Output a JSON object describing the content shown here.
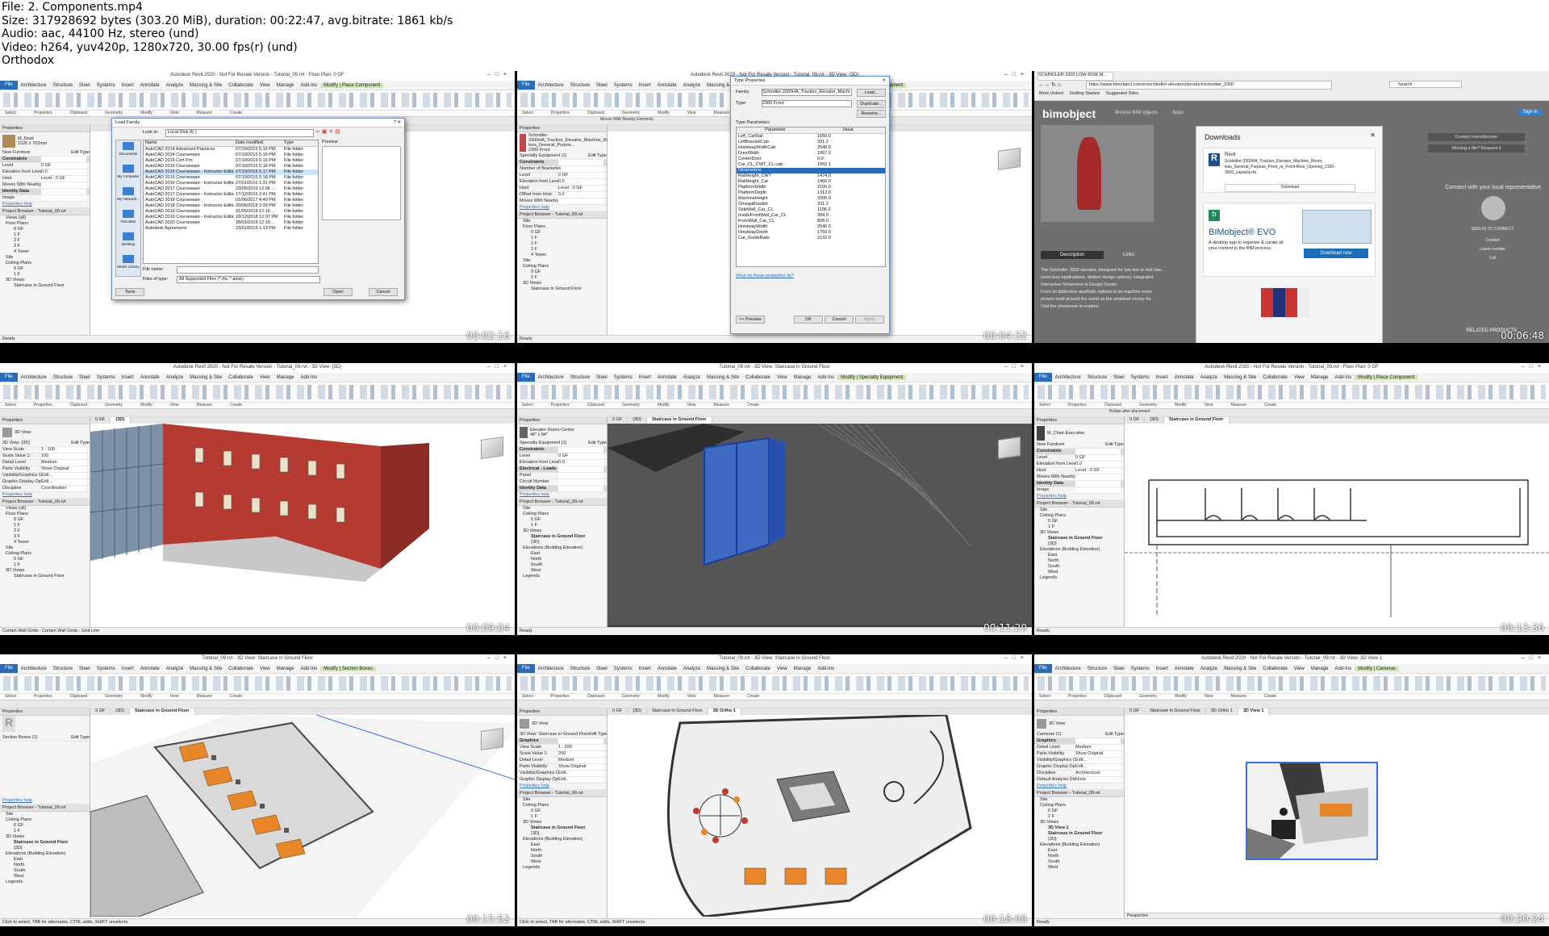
{
  "header": {
    "file": "File: 2. Components.mp4",
    "size": "Size: 317928692 bytes (303.20 MiB), duration: 00:22:47, avg.bitrate: 1861 kb/s",
    "audio": "Audio: aac, 44100 Hz, stereo (und)",
    "video": "Video: h264, yuv420p, 1280x720, 30.00 fps(r) (und)",
    "brand": "Orthodox"
  },
  "colors": {
    "revit_file_tab": "#2b6cb6",
    "context_tab": "#cfe8b8",
    "selection_blue": "#3a6fd8",
    "bim_green": "#2e9a5a"
  },
  "revit": {
    "menu_tabs": [
      "File",
      "Architecture",
      "Structure",
      "Steel",
      "Systems",
      "Insert",
      "Annotate",
      "Analyze",
      "Massing & Site",
      "Collaborate",
      "View",
      "Manage",
      "Add-Ins"
    ],
    "panels": [
      "Select",
      "Properties",
      "Clipboard",
      "Geometry",
      "Modify",
      "View",
      "Measure",
      "Create"
    ],
    "status_ready": "Ready",
    "scale": "1 : 100",
    "main_model": "Main Model"
  },
  "cells": [
    {
      "timestamp": "00:02:16",
      "title": "Autodesk Revit 2020 - Not For Resale Version - Tutorial_09.rvt - Floor Plan: 0 GF",
      "context_tab": "Modify | Place Component",
      "type_name": "M_Desk",
      "type_size": "1525 x 762mm",
      "category": "New Furniture",
      "edit_type": "Edit Type",
      "props": [
        "Constraints",
        "Level",
        "Elevation from Level",
        "Host",
        "Moves With Nearby ...",
        "Identity Data",
        "Image"
      ],
      "props_values": [
        "",
        "0 GF",
        "0.0",
        "Level : 0 GF",
        "",
        "",
        ""
      ],
      "properties_help": "Properties help",
      "apply": "Apply",
      "browser_title": "Project Browser - Tutorial_09.rvt",
      "tree": [
        "Views (all)",
        "Floor Plans",
        "0 GF",
        "1 F",
        "2 F",
        "3 F",
        "4 Tower",
        "Site",
        "Ceiling Plans",
        "0 GF",
        "1 F",
        "3D Views",
        "Staircase in Ground Floor"
      ],
      "dialog": {
        "title": "Load Family",
        "look_in_label": "Look in:",
        "look_in": "Local Disk (E:)",
        "columns": [
          "Name",
          "Date modified",
          "Type"
        ],
        "rows": [
          [
            "AutoCAD 2014 Advanced Practices",
            "07/10/2015 5:16 PM",
            "File folder"
          ],
          [
            "AutoCAD 2014 Courseware",
            "07/10/2015 5:16 PM",
            "File folder"
          ],
          [
            "AutoCAD 2015 Cert Pro",
            "07/10/2015 5:16 PM",
            "File folder"
          ],
          [
            "AutoCAD 2015 Courseware",
            "07/10/2015 5:16 PM",
            "File folder"
          ],
          [
            "AutoCAD 2015 Courseware - Instructor Edition",
            "07/10/2015 5:17 PM",
            "File folder"
          ],
          [
            "AutoCAD 2016 Courseware",
            "07/10/2015 5:18 PM",
            "File folder"
          ],
          [
            "AutoCAD 2016 Courseware - Instructor Edition",
            "27/01/2016 1:31 PM",
            "File folder"
          ],
          [
            "AutoCAD 2017 Courseware",
            "23/05/2016 12:06 ...",
            "File folder"
          ],
          [
            "AutoCAD 2017 Courseware - Instructor Edition",
            "17/12/2016 2:41 PM",
            "File folder"
          ],
          [
            "AutoCAD 2018 Courseware",
            "01/06/2017 4:49 PM",
            "File folder"
          ],
          [
            "AutoCAD 2018 Courseware - Instructor Edition",
            "20/06/2018 3:39 PM",
            "File folder"
          ],
          [
            "AutoCAD 2019 Courseware",
            "31/05/2018 12:15 ...",
            "File folder"
          ],
          [
            "AutoCAD 2019 Courseware - Instructor Edition",
            "18/12/2018 12:07 PM",
            "File folder"
          ],
          [
            "AutoCAD 2020 Courseware",
            "28/01/2019 12:19 ...",
            "File folder"
          ],
          [
            "Autodesk Agreement",
            "23/01/2019 1:13 PM",
            "File folder"
          ]
        ],
        "places": [
          "Documents",
          "My Computer",
          "My Network...",
          "Favorites",
          "Desktop",
          "Metric Library"
        ],
        "file_name_label": "File name:",
        "files_of_type_label": "Files of type:",
        "files_of_type": "All Supported Files (*.rfa, *.adsk)",
        "preview": "Preview",
        "tools": "Tools",
        "open": "Open",
        "cancel": "Cancel"
      }
    },
    {
      "timestamp": "00:04:32",
      "title": "Autodesk Revit 2020 - Not For Resale Version - Tutorial_09.rvt - 3D View: {3D}",
      "context_tab": "Modify | Specialty Equipment",
      "opt": "Moves With Nearby Elements",
      "type_name": "Schindler-3300HA_Traction_Elevator_Machine_Room-less_General_Purpos...",
      "type_size": "2300 Front",
      "category": "Specialty Equipment (1)",
      "props": [
        "Constraints",
        "Number of Brackets",
        "Level",
        "Elevation from Level",
        "Host",
        "Offset from Host",
        "Moves With Nearby ..."
      ],
      "props_values": [
        "",
        "4",
        "0 GF",
        "0.0",
        "Level : 0 GF",
        "0.0",
        ""
      ],
      "tree": [
        "Site",
        "Floor Plans",
        "0 GF",
        "1 F",
        "2 F",
        "3 F",
        "4 Tower",
        "Site",
        "Ceiling Plans",
        "0 GF",
        "1 F",
        "3D Views",
        "Staircase in Ground Floor"
      ],
      "dialog": {
        "title": "Type Properties",
        "family_label": "Family:",
        "family": "Schindler-3300HA_Traction_Elevator_Machi",
        "type_label": "Type:",
        "type": "2300 Front",
        "load": "Load...",
        "duplicate": "Duplicate...",
        "rename": "Rename...",
        "type_params": "Type Parameters",
        "columns": [
          "Parameter",
          "Value"
        ],
        "rows": [
          [
            "Left_CarRail",
            "1650.0"
          ],
          [
            "LeftBracketCab",
            "331.2"
          ],
          [
            "HoistwayWidthCab",
            "2540.0"
          ],
          [
            "DoorWidth",
            "1067.0"
          ],
          [
            "CenterDoor",
            "0.0"
          ],
          [
            "Car_CL_CWT_CL-cab",
            "1052.1"
          ],
          [
            "Dimensions",
            ""
          ],
          [
            "RailHeight_CWT",
            "1474.0"
          ],
          [
            "RailHeight_Car",
            "1466.0"
          ],
          [
            "PlatformWidth",
            "2100.0"
          ],
          [
            "PlatformDepth",
            "1312.0"
          ],
          [
            "MachineHeight",
            "3300.0"
          ],
          [
            "OmegaBracket",
            "331.2"
          ],
          [
            "SideWall_Car_CL",
            "1196.0"
          ],
          [
            "InsideFrontWall_Car_CL",
            "394.0"
          ],
          [
            "FrontWall_Car_CL",
            "808.0"
          ],
          [
            "HoistwayWidth",
            "2540.0"
          ],
          [
            "HoistwayDepth",
            "1750.0"
          ],
          [
            "Car_GuideRails",
            "2132.0"
          ]
        ],
        "help": "What do these properties do?",
        "preview": "<< Preview",
        "ok": "OK",
        "cancel": "Cancel",
        "apply": "Apply"
      }
    },
    {
      "timestamp": "00:06:48",
      "tab": "SCHINDLER 3300 LOW-RISE M...",
      "url": "https://www.bimobject.com/en/schindler-elevators/product/schindler_3300",
      "search": "Search",
      "bookmarks": [
        "Most Visited",
        "Getting Started",
        "Suggested Sites"
      ],
      "logo": "bimobject",
      "nav": [
        "Browse BIM objects",
        "Apps"
      ],
      "sign_in": "Sign in",
      "downloads_title": "Downloads",
      "rev_label": "Revit",
      "file_desc": "Schindler-3300HA_Traction_Elevator_Machine_Room-less_General_Purpose_Front_or_Front-Rear_Opening_2100-3500_capacity.rfa",
      "download": "Download",
      "evo_title": "BIMobject® EVO",
      "evo_desc": "A desktop app to organize & curate all your content in the BIM process.",
      "download_now": "Download now",
      "right_items": [
        "Contact manufacturer",
        "Missing a file? Request it"
      ],
      "connect": "Connect with your local representative",
      "sign_in_to_connect": "SIGN IN TO CONNECT",
      "contact_items": [
        "Contact",
        "Leave number",
        "Call"
      ],
      "tabs": [
        "Description",
        "Links"
      ],
      "desc_title": "The Schindler 3300 elevator, designed for low rise to mid rise...",
      "desc_lines": [
        "room-less applications, distinct design options, integrated",
        "Interactive Showroom & Design Center",
        "From its distinctive aesthetic options to its machine room",
        "proven itself around the world as the smartest choice for",
        "Visit the showroom to explore"
      ],
      "related": "RELATED PRODUCTS"
    },
    {
      "timestamp": "00:09:04",
      "title": "Autodesk Revit 2020 - Not For Resale Version - Tutorial_09.rvt - 3D View: {3D}",
      "type_name": "3D View",
      "category": "3D View: {3D}",
      "props": [
        "View Scale",
        "Scale Value 1:",
        "Detail Level",
        "Parts Visibility",
        "Visibility/Graphics O...",
        "Graphic Display Opti...",
        "Discipline"
      ],
      "props_values": [
        "1 : 100",
        "100",
        "Medium",
        "Show Original",
        "Edit...",
        "Edit...",
        "Coordination"
      ],
      "tree": [
        "Views (all)",
        "Floor Plans",
        "0 GF",
        "1 F",
        "2 F",
        "3 F",
        "4 Tower",
        "Site",
        "Ceiling Plans",
        "0 GF",
        "1 F",
        "3D Views",
        "Staircase in Ground Floor"
      ],
      "tabs": [
        "0 GF",
        "{3D}"
      ],
      "status": "Curtain Wall Grids : Curtain Wall Grids : Grid Line"
    },
    {
      "timestamp": "00:11:20",
      "title": "Tutorial_09.rvt - 3D View: Staircase in Ground Floor",
      "context_tab": "Modify | Specialty Equipment",
      "type_name": "Elevator Doors-Center",
      "type_size": "48\" x 84\"",
      "category": "Specialty Equipment (1)",
      "props": [
        "Constraints",
        "Level",
        "Elevation from Level",
        "Electrical - Loads",
        "Panel",
        "Circuit Number",
        "Identity Data"
      ],
      "props_values": [
        "",
        "0 GF",
        "0.0",
        "",
        "",
        "",
        ""
      ],
      "tree": [
        "Site",
        "Ceiling Plans",
        "0 GF",
        "1 F",
        "3D Views",
        "Staircase in Ground Floor",
        "{3D}",
        "Elevations (Building Elevation)",
        "East",
        "North",
        "South",
        "West",
        "Legends"
      ],
      "tabs": [
        "0 GF",
        "{3D}",
        "Staircase in Ground Floor"
      ]
    },
    {
      "timestamp": "00:13:36",
      "title": "Autodesk Revit 2020 - Not For Resale Version - Tutorial_09.rvt - Floor Plan: 0 GF",
      "context_tab": "Modify | Place Component",
      "opt": "Rotate after placement",
      "type_name": "M_Chair-Executive",
      "category": "New Furniture",
      "props": [
        "Constraints",
        "Level",
        "Elevation from Level",
        "Host",
        "Moves With Nearby ...",
        "Identity Data",
        "Image"
      ],
      "props_values": [
        "",
        "0 GF",
        "0.0",
        "Level : 0 GF",
        "",
        "",
        ""
      ],
      "tree": [
        "Site",
        "Ceiling Plans",
        "0 GF",
        "1 F",
        "3D Views",
        "Staircase in Ground Floor",
        "{3D}",
        "Elevations (Building Elevation)",
        "East",
        "North",
        "South",
        "West",
        "Legends"
      ],
      "tabs": [
        "0 GF",
        "{3D}",
        "Staircase in Ground Floor"
      ]
    },
    {
      "timestamp": "00:15:52",
      "title": "Tutorial_09.rvt - 3D View: Staircase in Ground Floor",
      "context_tab": "Modify | Section Boxes",
      "category": "Section Boxes (1)",
      "tree": [
        "Site",
        "Ceiling Plans",
        "0 GF",
        "1 F",
        "3D Views",
        "Staircase in Ground Floor",
        "{3D}",
        "Elevations (Building Elevation)",
        "East",
        "North",
        "South",
        "West",
        "Legends"
      ],
      "tabs": [
        "0 GF",
        "{3D}",
        "Staircase in Ground Floor"
      ],
      "status": "Click to select, TAB for alternates, CTRL adds, SHIFT unselects."
    },
    {
      "timestamp": "00:18:08",
      "title": "Tutorial_09.rvt - 3D View: Staircase in Ground Floor",
      "type_name": "3D View",
      "category": "3D View: Staircase in Ground Floor",
      "props": [
        "Graphics",
        "View Scale",
        "Scale Value 1:",
        "Detail Level",
        "Parts Visibility",
        "Visibility/Graphics O...",
        "Graphic Display Opti..."
      ],
      "props_values": [
        "",
        "1 : 200",
        "200",
        "Medium",
        "Show Original",
        "Edit...",
        "Edit..."
      ],
      "tree": [
        "Site",
        "Ceiling Plans",
        "0 GF",
        "1 F",
        "3D Views",
        "Staircase in Ground Floor",
        "{3D}",
        "Elevations (Building Elevation)",
        "East",
        "North",
        "South",
        "West",
        "Legends"
      ],
      "tabs": [
        "0 GF",
        "{3D}",
        "Staircase in Ground Floor",
        "3D Ortho 1"
      ],
      "status": "Click to select, TAB for alternates, CTRL adds, SHIFT unselects."
    },
    {
      "timestamp": "00:20:24",
      "title": "Autodesk Revit 2020 - Not For Resale Version - Tutorial_09.rvt - 3D View: 3D View 1",
      "context_tab": "Modify | Cameras",
      "type_name": "3D View",
      "category": "Cameras (1)",
      "props": [
        "Graphics",
        "Detail Level",
        "Parts Visibility",
        "Visibility/Graphics O...",
        "Graphic Display Opti...",
        "Discipline",
        "Default Analysis Disp..."
      ],
      "props_values": [
        "",
        "Medium",
        "Show Original",
        "Edit...",
        "Edit...",
        "Architectural",
        "None"
      ],
      "tree": [
        "Site",
        "Ceiling Plans",
        "0 GF",
        "1 F",
        "3D Views",
        "3D View 1",
        "Staircase in Ground Floor",
        "{3D}",
        "Elevations (Building Elevation)",
        "East",
        "North",
        "South",
        "West"
      ],
      "tabs": [
        "0 GF",
        "Staircase in Ground Floor",
        "3D Ortho 1",
        "3D View 1"
      ],
      "perspective": "Perspective"
    }
  ]
}
